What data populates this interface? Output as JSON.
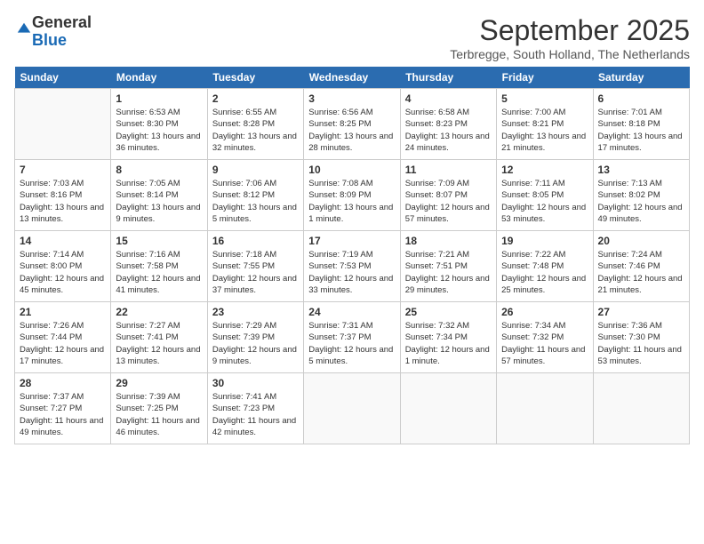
{
  "logo": {
    "general": "General",
    "blue": "Blue"
  },
  "header": {
    "month": "September 2025",
    "location": "Terbregge, South Holland, The Netherlands"
  },
  "weekdays": [
    "Sunday",
    "Monday",
    "Tuesday",
    "Wednesday",
    "Thursday",
    "Friday",
    "Saturday"
  ],
  "weeks": [
    [
      {
        "day": "",
        "sunrise": "",
        "sunset": "",
        "daylight": ""
      },
      {
        "day": "1",
        "sunrise": "Sunrise: 6:53 AM",
        "sunset": "Sunset: 8:30 PM",
        "daylight": "Daylight: 13 hours and 36 minutes."
      },
      {
        "day": "2",
        "sunrise": "Sunrise: 6:55 AM",
        "sunset": "Sunset: 8:28 PM",
        "daylight": "Daylight: 13 hours and 32 minutes."
      },
      {
        "day": "3",
        "sunrise": "Sunrise: 6:56 AM",
        "sunset": "Sunset: 8:25 PM",
        "daylight": "Daylight: 13 hours and 28 minutes."
      },
      {
        "day": "4",
        "sunrise": "Sunrise: 6:58 AM",
        "sunset": "Sunset: 8:23 PM",
        "daylight": "Daylight: 13 hours and 24 minutes."
      },
      {
        "day": "5",
        "sunrise": "Sunrise: 7:00 AM",
        "sunset": "Sunset: 8:21 PM",
        "daylight": "Daylight: 13 hours and 21 minutes."
      },
      {
        "day": "6",
        "sunrise": "Sunrise: 7:01 AM",
        "sunset": "Sunset: 8:18 PM",
        "daylight": "Daylight: 13 hours and 17 minutes."
      }
    ],
    [
      {
        "day": "7",
        "sunrise": "Sunrise: 7:03 AM",
        "sunset": "Sunset: 8:16 PM",
        "daylight": "Daylight: 13 hours and 13 minutes."
      },
      {
        "day": "8",
        "sunrise": "Sunrise: 7:05 AM",
        "sunset": "Sunset: 8:14 PM",
        "daylight": "Daylight: 13 hours and 9 minutes."
      },
      {
        "day": "9",
        "sunrise": "Sunrise: 7:06 AM",
        "sunset": "Sunset: 8:12 PM",
        "daylight": "Daylight: 13 hours and 5 minutes."
      },
      {
        "day": "10",
        "sunrise": "Sunrise: 7:08 AM",
        "sunset": "Sunset: 8:09 PM",
        "daylight": "Daylight: 13 hours and 1 minute."
      },
      {
        "day": "11",
        "sunrise": "Sunrise: 7:09 AM",
        "sunset": "Sunset: 8:07 PM",
        "daylight": "Daylight: 12 hours and 57 minutes."
      },
      {
        "day": "12",
        "sunrise": "Sunrise: 7:11 AM",
        "sunset": "Sunset: 8:05 PM",
        "daylight": "Daylight: 12 hours and 53 minutes."
      },
      {
        "day": "13",
        "sunrise": "Sunrise: 7:13 AM",
        "sunset": "Sunset: 8:02 PM",
        "daylight": "Daylight: 12 hours and 49 minutes."
      }
    ],
    [
      {
        "day": "14",
        "sunrise": "Sunrise: 7:14 AM",
        "sunset": "Sunset: 8:00 PM",
        "daylight": "Daylight: 12 hours and 45 minutes."
      },
      {
        "day": "15",
        "sunrise": "Sunrise: 7:16 AM",
        "sunset": "Sunset: 7:58 PM",
        "daylight": "Daylight: 12 hours and 41 minutes."
      },
      {
        "day": "16",
        "sunrise": "Sunrise: 7:18 AM",
        "sunset": "Sunset: 7:55 PM",
        "daylight": "Daylight: 12 hours and 37 minutes."
      },
      {
        "day": "17",
        "sunrise": "Sunrise: 7:19 AM",
        "sunset": "Sunset: 7:53 PM",
        "daylight": "Daylight: 12 hours and 33 minutes."
      },
      {
        "day": "18",
        "sunrise": "Sunrise: 7:21 AM",
        "sunset": "Sunset: 7:51 PM",
        "daylight": "Daylight: 12 hours and 29 minutes."
      },
      {
        "day": "19",
        "sunrise": "Sunrise: 7:22 AM",
        "sunset": "Sunset: 7:48 PM",
        "daylight": "Daylight: 12 hours and 25 minutes."
      },
      {
        "day": "20",
        "sunrise": "Sunrise: 7:24 AM",
        "sunset": "Sunset: 7:46 PM",
        "daylight": "Daylight: 12 hours and 21 minutes."
      }
    ],
    [
      {
        "day": "21",
        "sunrise": "Sunrise: 7:26 AM",
        "sunset": "Sunset: 7:44 PM",
        "daylight": "Daylight: 12 hours and 17 minutes."
      },
      {
        "day": "22",
        "sunrise": "Sunrise: 7:27 AM",
        "sunset": "Sunset: 7:41 PM",
        "daylight": "Daylight: 12 hours and 13 minutes."
      },
      {
        "day": "23",
        "sunrise": "Sunrise: 7:29 AM",
        "sunset": "Sunset: 7:39 PM",
        "daylight": "Daylight: 12 hours and 9 minutes."
      },
      {
        "day": "24",
        "sunrise": "Sunrise: 7:31 AM",
        "sunset": "Sunset: 7:37 PM",
        "daylight": "Daylight: 12 hours and 5 minutes."
      },
      {
        "day": "25",
        "sunrise": "Sunrise: 7:32 AM",
        "sunset": "Sunset: 7:34 PM",
        "daylight": "Daylight: 12 hours and 1 minute."
      },
      {
        "day": "26",
        "sunrise": "Sunrise: 7:34 AM",
        "sunset": "Sunset: 7:32 PM",
        "daylight": "Daylight: 11 hours and 57 minutes."
      },
      {
        "day": "27",
        "sunrise": "Sunrise: 7:36 AM",
        "sunset": "Sunset: 7:30 PM",
        "daylight": "Daylight: 11 hours and 53 minutes."
      }
    ],
    [
      {
        "day": "28",
        "sunrise": "Sunrise: 7:37 AM",
        "sunset": "Sunset: 7:27 PM",
        "daylight": "Daylight: 11 hours and 49 minutes."
      },
      {
        "day": "29",
        "sunrise": "Sunrise: 7:39 AM",
        "sunset": "Sunset: 7:25 PM",
        "daylight": "Daylight: 11 hours and 46 minutes."
      },
      {
        "day": "30",
        "sunrise": "Sunrise: 7:41 AM",
        "sunset": "Sunset: 7:23 PM",
        "daylight": "Daylight: 11 hours and 42 minutes."
      },
      {
        "day": "",
        "sunrise": "",
        "sunset": "",
        "daylight": ""
      },
      {
        "day": "",
        "sunrise": "",
        "sunset": "",
        "daylight": ""
      },
      {
        "day": "",
        "sunrise": "",
        "sunset": "",
        "daylight": ""
      },
      {
        "day": "",
        "sunrise": "",
        "sunset": "",
        "daylight": ""
      }
    ]
  ]
}
